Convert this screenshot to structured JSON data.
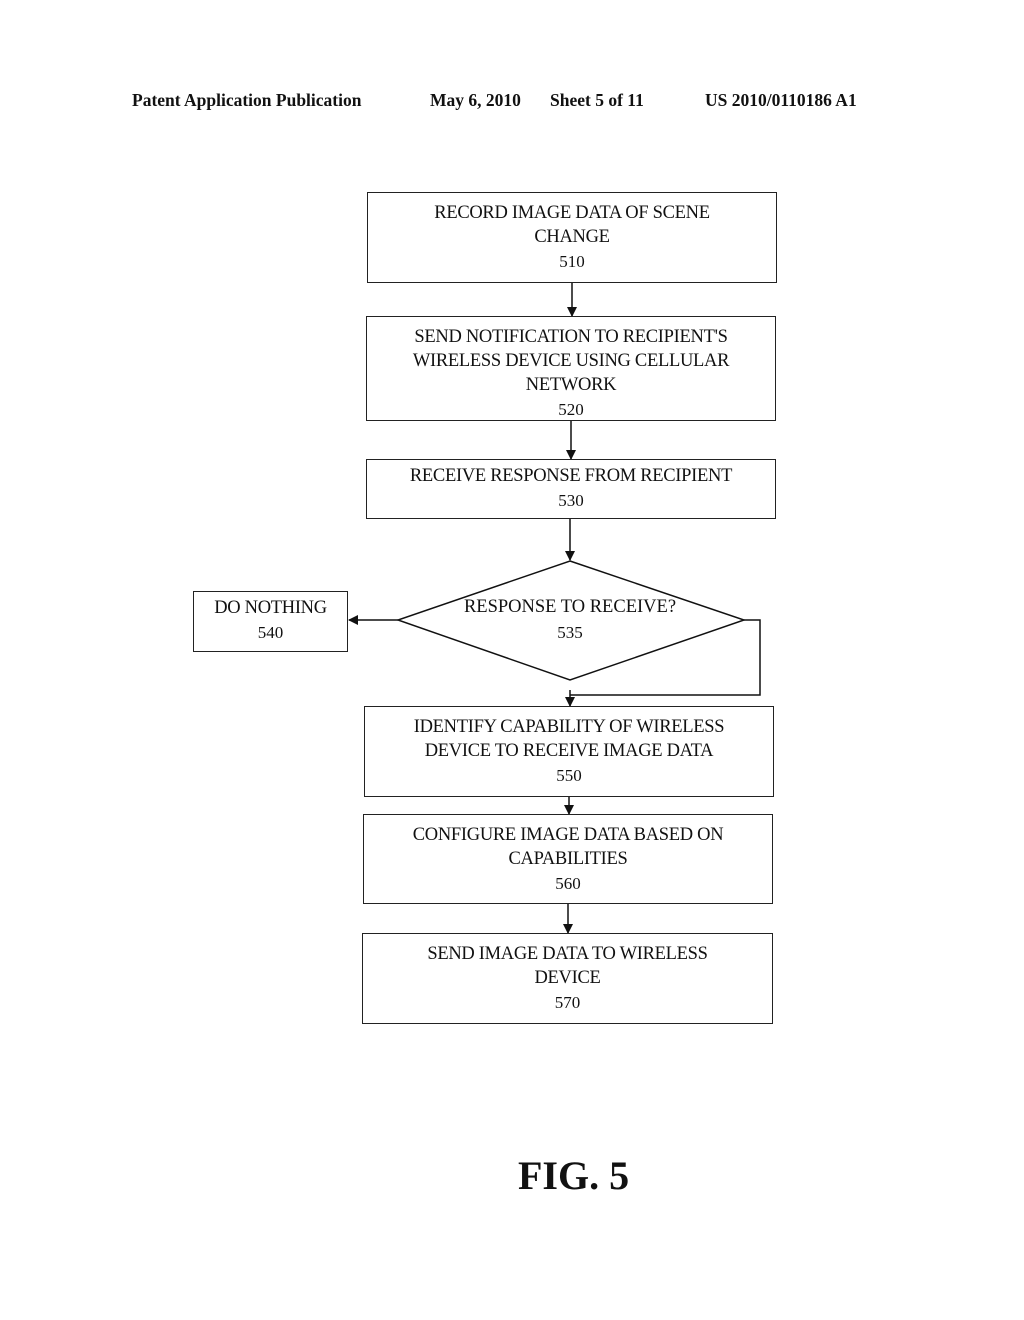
{
  "header": {
    "publication": "Patent Application Publication",
    "date": "May 6, 2010",
    "sheet": "Sheet 5 of 11",
    "number": "US 2010/0110186 A1"
  },
  "steps": {
    "s510": {
      "label_lines": [
        "RECORD IMAGE DATA OF SCENE",
        "CHANGE"
      ],
      "num": "510"
    },
    "s520": {
      "label_lines": [
        "SEND NOTIFICATION TO RECIPIENT'S",
        "WIRELESS DEVICE USING CELLULAR",
        "NETWORK"
      ],
      "num": "520"
    },
    "s530": {
      "label_lines": [
        "RECEIVE RESPONSE FROM RECIPIENT"
      ],
      "num": "530"
    },
    "s535": {
      "label_lines": [
        "RESPONSE TO RECEIVE?"
      ],
      "num": "535"
    },
    "s540": {
      "label_lines": [
        "DO NOTHING"
      ],
      "num": "540"
    },
    "s550": {
      "label_lines": [
        "IDENTIFY CAPABILITY OF WIRELESS",
        "DEVICE TO RECEIVE IMAGE DATA"
      ],
      "num": "550"
    },
    "s560": {
      "label_lines": [
        "CONFIGURE IMAGE DATA BASED ON",
        "CAPABILITIES"
      ],
      "num": "560"
    },
    "s570": {
      "label_lines": [
        "SEND IMAGE DATA TO WIRELESS",
        "DEVICE"
      ],
      "num": "570"
    }
  },
  "figure_label": "FIG. 5"
}
